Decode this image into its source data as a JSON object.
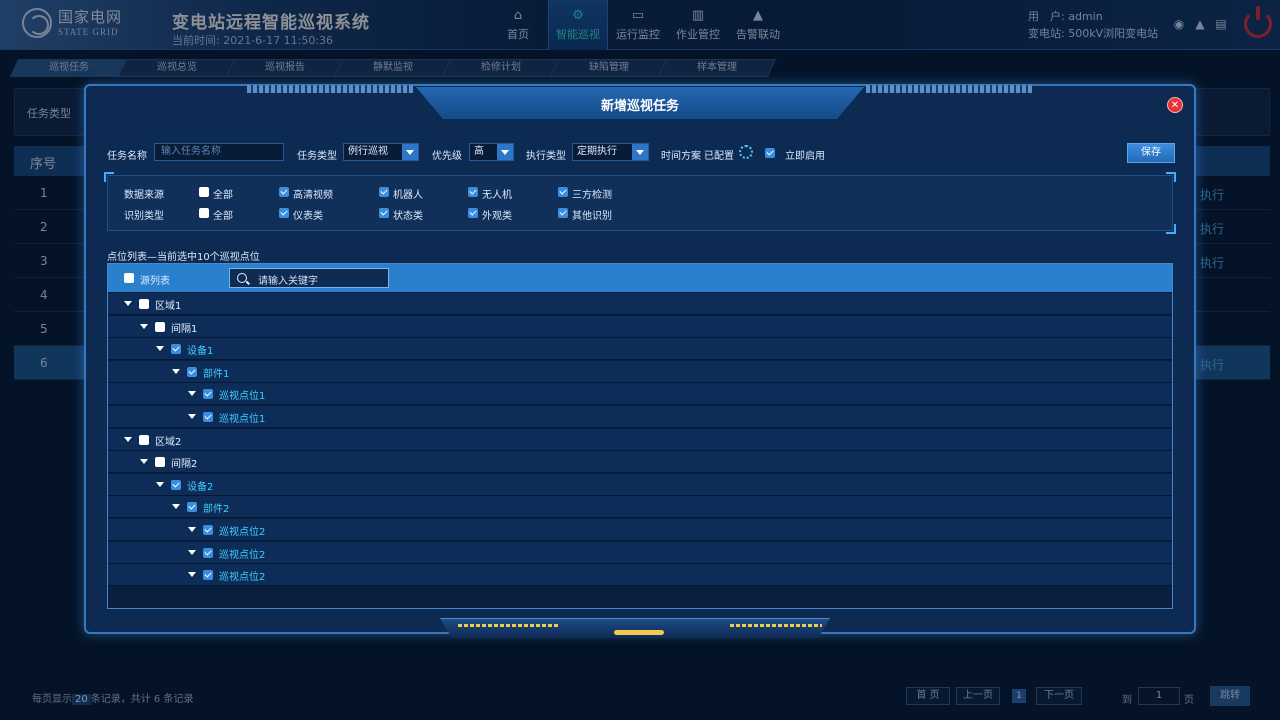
{
  "header": {
    "logo_cn": "国家电网",
    "logo_en": "STATE GRID",
    "title": "变电站远程智能巡视系统",
    "time": "当前时间:  2021-6-17  11:50:36",
    "nav": [
      {
        "label": "首页",
        "icon": "home-icon"
      },
      {
        "label": "智能巡视",
        "icon": "gear-icon"
      },
      {
        "label": "运行监控",
        "icon": "monitor-icon"
      },
      {
        "label": "作业管控",
        "icon": "book-icon"
      },
      {
        "label": "告警联动",
        "icon": "alert-icon"
      }
    ],
    "user": "用　户: admin",
    "station": "变电站: 500kV浏阳变电站"
  },
  "subnav": [
    "巡视任务",
    "巡视总览",
    "巡视报告",
    "静默监视",
    "检修计划",
    "缺陷管理",
    "样本管理"
  ],
  "background": {
    "filter_label": "任务类型",
    "table_head": "序号",
    "rows": [
      "1",
      "2",
      "3",
      "4",
      "5",
      "6"
    ],
    "action_label": "执行",
    "footer_prefix": "每页显示",
    "page_size": "20",
    "footer_suffix": "条记录，共计 6 条记录",
    "first": "首 页",
    "prev": "上一页",
    "current": "1",
    "next": "下一页",
    "goto_label": "到",
    "goto_value": "1",
    "page_unit": "页",
    "jump": "跳转"
  },
  "modal": {
    "title": "新增巡视任务",
    "task_name_label": "任务名称",
    "task_name_placeholder": "输入任务名称",
    "task_type_label": "任务类型",
    "task_type_value": "例行巡视",
    "priority_label": "优先级",
    "priority_value": "高",
    "exec_type_label": "执行类型",
    "exec_type_value": "定期执行",
    "schedule_label": "时间方案",
    "schedule_value": "已配置",
    "enable_label": "立即启用",
    "save": "保存",
    "source_label": "数据来源",
    "sources": [
      "全部",
      "高清视频",
      "机器人",
      "无人机",
      "三方检测"
    ],
    "recog_label": "识别类型",
    "recogs": [
      "全部",
      "仪表类",
      "状态类",
      "外观类",
      "其他识别"
    ],
    "list_title": "点位列表—当前选中10个巡视点位",
    "source_list_label": "源列表",
    "search_placeholder": "请输入关键字",
    "tree": [
      {
        "level": 0,
        "label": "区域1",
        "checked": false
      },
      {
        "level": 1,
        "label": "间隔1",
        "checked": false
      },
      {
        "level": 2,
        "label": "设备1",
        "checked": true
      },
      {
        "level": 3,
        "label": "部件1",
        "checked": true
      },
      {
        "level": 4,
        "label": "巡视点位1",
        "checked": true
      },
      {
        "level": 4,
        "label": "巡视点位1",
        "checked": true
      },
      {
        "level": 0,
        "label": "区域2",
        "checked": false
      },
      {
        "level": 1,
        "label": "间隔2",
        "checked": false
      },
      {
        "level": 2,
        "label": "设备2",
        "checked": true
      },
      {
        "level": 3,
        "label": "部件2",
        "checked": true
      },
      {
        "level": 4,
        "label": "巡视点位2",
        "checked": true
      },
      {
        "level": 4,
        "label": "巡视点位2",
        "checked": true
      },
      {
        "level": 4,
        "label": "巡视点位2",
        "checked": true
      }
    ]
  },
  "colors": {
    "accent": "#39e3d4",
    "checked_text": "#3fd0ff",
    "close": "#e2363c"
  }
}
